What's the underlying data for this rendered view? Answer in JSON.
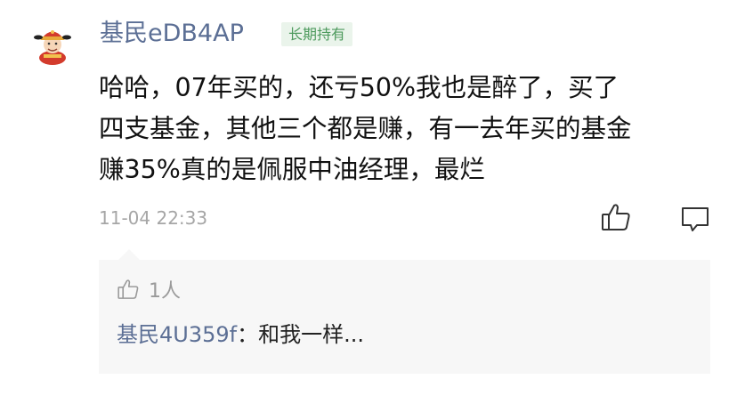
{
  "comment": {
    "username": "基民eDB4AP",
    "badge": "长期持有",
    "avatar_icon": "fortune-god-avatar-icon",
    "text_lines": [
      "哈哈，07年买的，还亏50%我也是醉了，买了",
      "四支基金，其他三个都是赚，有一去年买的基金",
      "赚35%真的是佩服中油经理，最烂"
    ],
    "timestamp": "11-04 22:33",
    "like_icon": "thumbs-up-icon",
    "reply_icon": "speech-bubble-icon"
  },
  "reply_section": {
    "like_icon": "thumbs-up-icon",
    "like_count": "1人",
    "reply": {
      "username": "基民4U359f",
      "separator": "：",
      "text": "和我一样..."
    }
  },
  "colors": {
    "username": "#5c6f95",
    "badge_text": "#4d9a5d",
    "badge_bg": "#eaf4eb",
    "body_text": "#111111",
    "meta_text": "#a6a6a6",
    "reply_bg": "#f7f7f7"
  }
}
